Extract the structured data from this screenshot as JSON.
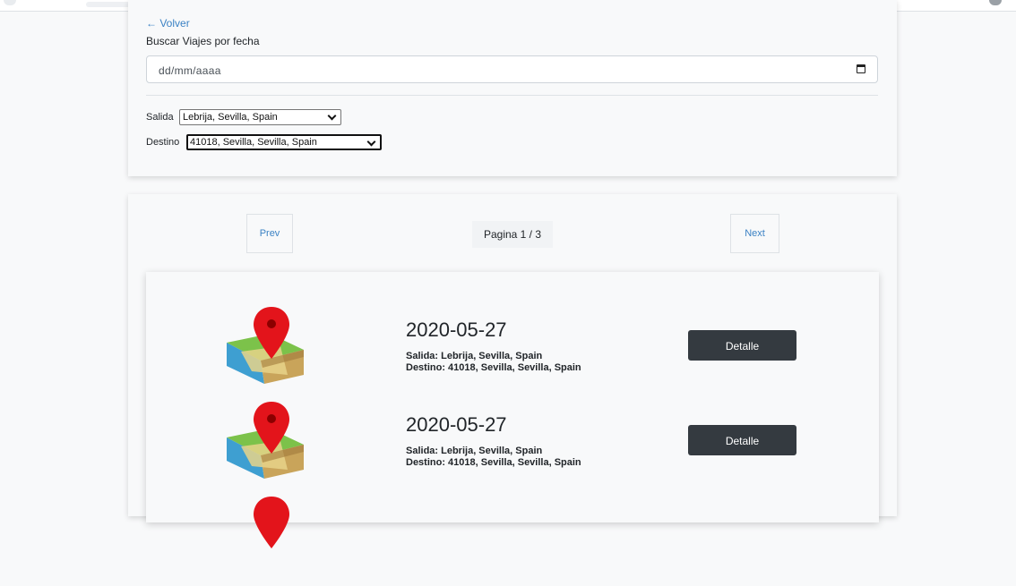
{
  "nav": {
    "back_label": "← Volver"
  },
  "search": {
    "title": "Buscar Viajes por fecha",
    "date_placeholder": "dd/mm/aaaa"
  },
  "filters": {
    "origin_label": "Salida",
    "origin_value": "Lebrija, Sevilla, Spain",
    "destination_label": "Destino",
    "destination_value": "41018, Sevilla, Sevilla, Spain"
  },
  "pagination": {
    "prev_label": "Prev",
    "next_label": "Next",
    "page_text": "Pagina 1 / 3"
  },
  "trips": [
    {
      "date": "2020-05-27",
      "origin": "Salida: Lebrija, Sevilla, Spain",
      "destination": "Destino: 41018, Sevilla, Sevilla, Spain",
      "button_label": "Detalle"
    },
    {
      "date": "2020-05-27",
      "origin": "Salida: Lebrija, Sevilla, Spain",
      "destination": "Destino: 41018, Sevilla, Sevilla, Spain",
      "button_label": "Detalle"
    }
  ],
  "icons": {
    "trip_icon": "map-pin-icon",
    "calendar": "calendar-icon",
    "select_chevron": "chevron-down-icon"
  },
  "colors": {
    "link": "#3b82c4",
    "button_dark": "#343a40",
    "pin_red": "#e3141b"
  }
}
